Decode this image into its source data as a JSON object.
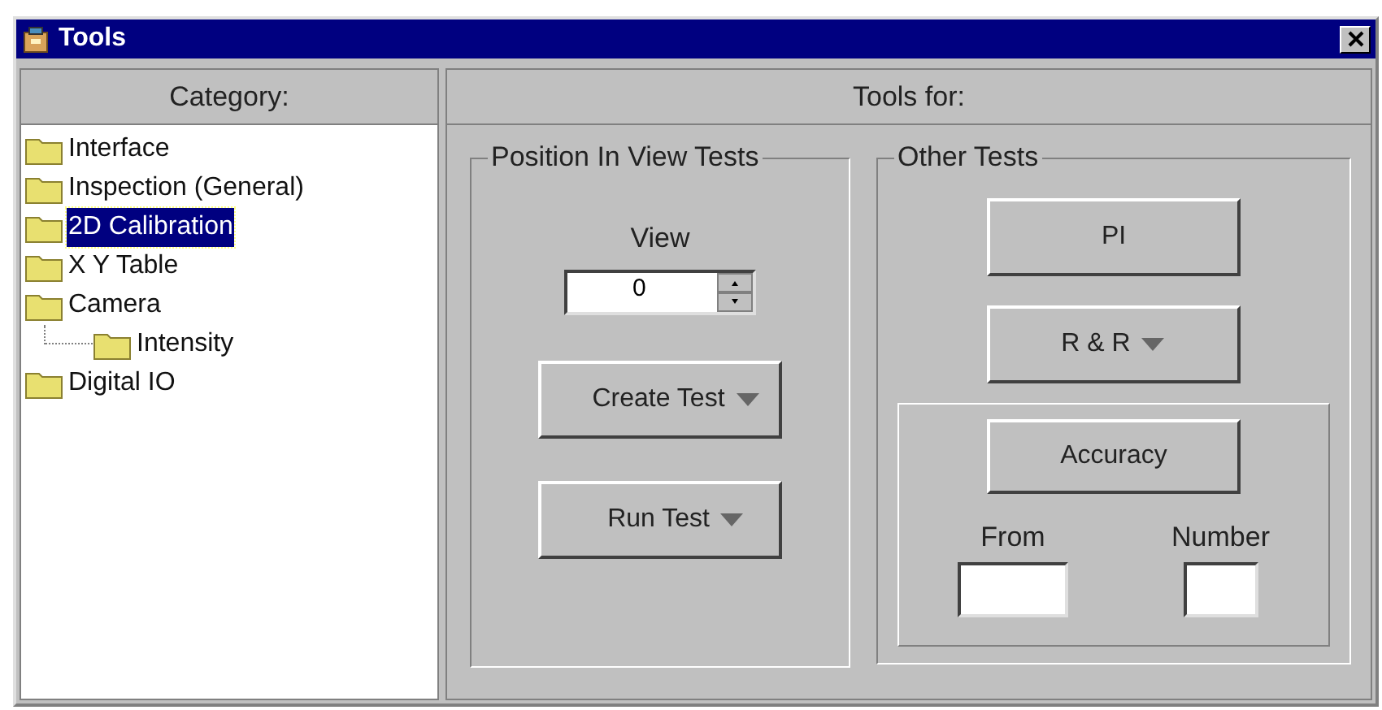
{
  "window": {
    "title": "Tools"
  },
  "category_panel": {
    "header": "Category:",
    "tree": [
      {
        "label": "Interface",
        "selected": false
      },
      {
        "label": "Inspection (General)",
        "selected": false
      },
      {
        "label": "2D Calibration",
        "selected": true
      },
      {
        "label": "X Y Table",
        "selected": false
      },
      {
        "label": "Camera",
        "selected": false,
        "children": [
          {
            "label": "Intensity",
            "selected": false
          }
        ]
      },
      {
        "label": "Digital IO",
        "selected": false
      }
    ]
  },
  "tools_panel": {
    "header": "Tools for:",
    "position_group": {
      "title": "Position In View Tests",
      "view_label": "View",
      "view_value": "0",
      "buttons": [
        {
          "label": "Create Test",
          "kind": "dropdown"
        },
        {
          "label": "Run Test",
          "kind": "dropdown"
        }
      ]
    },
    "other_group": {
      "title": "Other Tests",
      "buttons": [
        {
          "label": "PI",
          "kind": "plain"
        },
        {
          "label": "R & R",
          "kind": "dropdown"
        }
      ],
      "accuracy": {
        "button": "Accuracy",
        "from_label": "From",
        "number_label": "Number"
      }
    }
  }
}
